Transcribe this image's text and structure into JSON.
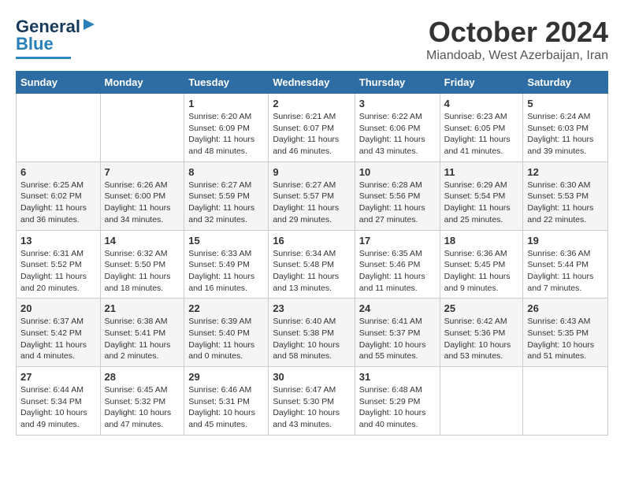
{
  "header": {
    "logo_general": "General",
    "logo_blue": "Blue",
    "title": "October 2024",
    "subtitle": "Miandoab, West Azerbaijan, Iran"
  },
  "columns": [
    "Sunday",
    "Monday",
    "Tuesday",
    "Wednesday",
    "Thursday",
    "Friday",
    "Saturday"
  ],
  "weeks": [
    [
      {
        "day": "",
        "sunrise": "",
        "sunset": "",
        "daylight": ""
      },
      {
        "day": "",
        "sunrise": "",
        "sunset": "",
        "daylight": ""
      },
      {
        "day": "1",
        "sunrise": "Sunrise: 6:20 AM",
        "sunset": "Sunset: 6:09 PM",
        "daylight": "Daylight: 11 hours and 48 minutes."
      },
      {
        "day": "2",
        "sunrise": "Sunrise: 6:21 AM",
        "sunset": "Sunset: 6:07 PM",
        "daylight": "Daylight: 11 hours and 46 minutes."
      },
      {
        "day": "3",
        "sunrise": "Sunrise: 6:22 AM",
        "sunset": "Sunset: 6:06 PM",
        "daylight": "Daylight: 11 hours and 43 minutes."
      },
      {
        "day": "4",
        "sunrise": "Sunrise: 6:23 AM",
        "sunset": "Sunset: 6:05 PM",
        "daylight": "Daylight: 11 hours and 41 minutes."
      },
      {
        "day": "5",
        "sunrise": "Sunrise: 6:24 AM",
        "sunset": "Sunset: 6:03 PM",
        "daylight": "Daylight: 11 hours and 39 minutes."
      }
    ],
    [
      {
        "day": "6",
        "sunrise": "Sunrise: 6:25 AM",
        "sunset": "Sunset: 6:02 PM",
        "daylight": "Daylight: 11 hours and 36 minutes."
      },
      {
        "day": "7",
        "sunrise": "Sunrise: 6:26 AM",
        "sunset": "Sunset: 6:00 PM",
        "daylight": "Daylight: 11 hours and 34 minutes."
      },
      {
        "day": "8",
        "sunrise": "Sunrise: 6:27 AM",
        "sunset": "Sunset: 5:59 PM",
        "daylight": "Daylight: 11 hours and 32 minutes."
      },
      {
        "day": "9",
        "sunrise": "Sunrise: 6:27 AM",
        "sunset": "Sunset: 5:57 PM",
        "daylight": "Daylight: 11 hours and 29 minutes."
      },
      {
        "day": "10",
        "sunrise": "Sunrise: 6:28 AM",
        "sunset": "Sunset: 5:56 PM",
        "daylight": "Daylight: 11 hours and 27 minutes."
      },
      {
        "day": "11",
        "sunrise": "Sunrise: 6:29 AM",
        "sunset": "Sunset: 5:54 PM",
        "daylight": "Daylight: 11 hours and 25 minutes."
      },
      {
        "day": "12",
        "sunrise": "Sunrise: 6:30 AM",
        "sunset": "Sunset: 5:53 PM",
        "daylight": "Daylight: 11 hours and 22 minutes."
      }
    ],
    [
      {
        "day": "13",
        "sunrise": "Sunrise: 6:31 AM",
        "sunset": "Sunset: 5:52 PM",
        "daylight": "Daylight: 11 hours and 20 minutes."
      },
      {
        "day": "14",
        "sunrise": "Sunrise: 6:32 AM",
        "sunset": "Sunset: 5:50 PM",
        "daylight": "Daylight: 11 hours and 18 minutes."
      },
      {
        "day": "15",
        "sunrise": "Sunrise: 6:33 AM",
        "sunset": "Sunset: 5:49 PM",
        "daylight": "Daylight: 11 hours and 16 minutes."
      },
      {
        "day": "16",
        "sunrise": "Sunrise: 6:34 AM",
        "sunset": "Sunset: 5:48 PM",
        "daylight": "Daylight: 11 hours and 13 minutes."
      },
      {
        "day": "17",
        "sunrise": "Sunrise: 6:35 AM",
        "sunset": "Sunset: 5:46 PM",
        "daylight": "Daylight: 11 hours and 11 minutes."
      },
      {
        "day": "18",
        "sunrise": "Sunrise: 6:36 AM",
        "sunset": "Sunset: 5:45 PM",
        "daylight": "Daylight: 11 hours and 9 minutes."
      },
      {
        "day": "19",
        "sunrise": "Sunrise: 6:36 AM",
        "sunset": "Sunset: 5:44 PM",
        "daylight": "Daylight: 11 hours and 7 minutes."
      }
    ],
    [
      {
        "day": "20",
        "sunrise": "Sunrise: 6:37 AM",
        "sunset": "Sunset: 5:42 PM",
        "daylight": "Daylight: 11 hours and 4 minutes."
      },
      {
        "day": "21",
        "sunrise": "Sunrise: 6:38 AM",
        "sunset": "Sunset: 5:41 PM",
        "daylight": "Daylight: 11 hours and 2 minutes."
      },
      {
        "day": "22",
        "sunrise": "Sunrise: 6:39 AM",
        "sunset": "Sunset: 5:40 PM",
        "daylight": "Daylight: 11 hours and 0 minutes."
      },
      {
        "day": "23",
        "sunrise": "Sunrise: 6:40 AM",
        "sunset": "Sunset: 5:38 PM",
        "daylight": "Daylight: 10 hours and 58 minutes."
      },
      {
        "day": "24",
        "sunrise": "Sunrise: 6:41 AM",
        "sunset": "Sunset: 5:37 PM",
        "daylight": "Daylight: 10 hours and 55 minutes."
      },
      {
        "day": "25",
        "sunrise": "Sunrise: 6:42 AM",
        "sunset": "Sunset: 5:36 PM",
        "daylight": "Daylight: 10 hours and 53 minutes."
      },
      {
        "day": "26",
        "sunrise": "Sunrise: 6:43 AM",
        "sunset": "Sunset: 5:35 PM",
        "daylight": "Daylight: 10 hours and 51 minutes."
      }
    ],
    [
      {
        "day": "27",
        "sunrise": "Sunrise: 6:44 AM",
        "sunset": "Sunset: 5:34 PM",
        "daylight": "Daylight: 10 hours and 49 minutes."
      },
      {
        "day": "28",
        "sunrise": "Sunrise: 6:45 AM",
        "sunset": "Sunset: 5:32 PM",
        "daylight": "Daylight: 10 hours and 47 minutes."
      },
      {
        "day": "29",
        "sunrise": "Sunrise: 6:46 AM",
        "sunset": "Sunset: 5:31 PM",
        "daylight": "Daylight: 10 hours and 45 minutes."
      },
      {
        "day": "30",
        "sunrise": "Sunrise: 6:47 AM",
        "sunset": "Sunset: 5:30 PM",
        "daylight": "Daylight: 10 hours and 43 minutes."
      },
      {
        "day": "31",
        "sunrise": "Sunrise: 6:48 AM",
        "sunset": "Sunset: 5:29 PM",
        "daylight": "Daylight: 10 hours and 40 minutes."
      },
      {
        "day": "",
        "sunrise": "",
        "sunset": "",
        "daylight": ""
      },
      {
        "day": "",
        "sunrise": "",
        "sunset": "",
        "daylight": ""
      }
    ]
  ]
}
